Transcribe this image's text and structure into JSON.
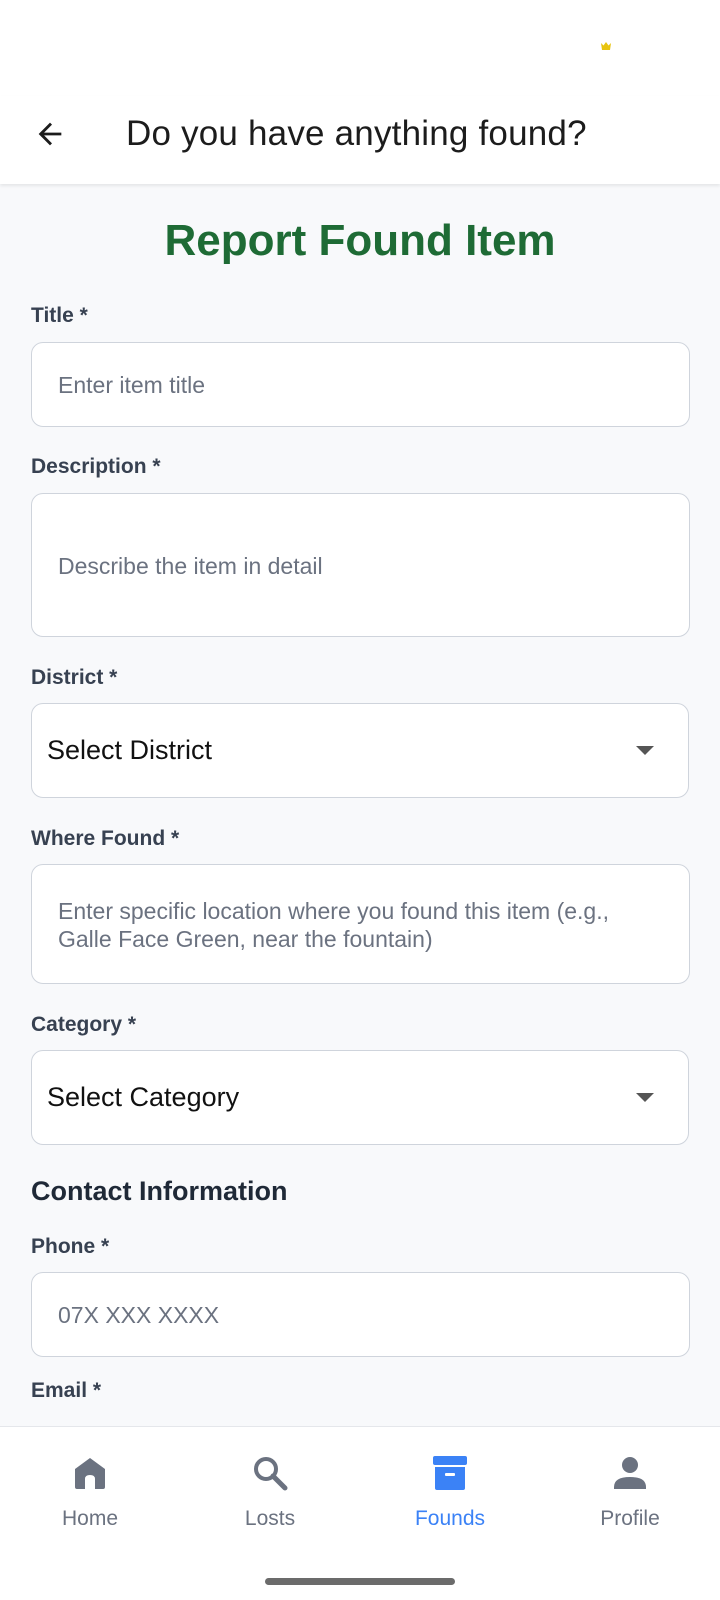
{
  "appbar": {
    "title": "Do you have anything found?"
  },
  "form": {
    "heading": "Report Found Item",
    "title_label": "Title *",
    "title_placeholder": "Enter item title",
    "description_label": "Description *",
    "description_placeholder": "Describe the item in detail",
    "district_label": "District *",
    "district_value": "Select District",
    "where_label": "Where Found *",
    "where_placeholder": "Enter specific location where you found this item (e.g., Galle Face Green, near the fountain)",
    "category_label": "Category *",
    "category_value": "Select Category",
    "contact_heading": "Contact Information",
    "phone_label": "Phone *",
    "phone_placeholder": "07X XXX XXXX",
    "email_label": "Email *"
  },
  "nav": {
    "items": [
      {
        "label": "Home",
        "icon": "home-icon"
      },
      {
        "label": "Losts",
        "icon": "search-icon"
      },
      {
        "label": "Founds",
        "icon": "archive-box-icon",
        "active": true
      },
      {
        "label": "Profile",
        "icon": "person-icon"
      }
    ]
  },
  "colors": {
    "heading_green": "#1e6b35",
    "active_blue": "#3b82f6",
    "inactive_grey": "#6b7280"
  }
}
